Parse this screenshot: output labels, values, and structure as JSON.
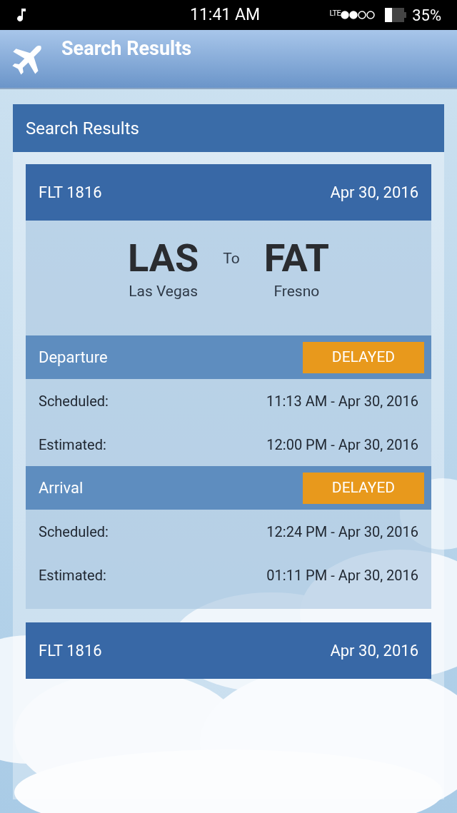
{
  "status_bar": {
    "time": "11:41 AM",
    "network": "LTE",
    "battery": "35%"
  },
  "app_bar": {
    "title": "Search Results"
  },
  "panel": {
    "title": "Search Results"
  },
  "flights": [
    {
      "flight": "FLT 1816",
      "date": "Apr 30, 2016",
      "origin": {
        "code": "LAS",
        "city": "Las Vegas"
      },
      "connector": "To",
      "destination": {
        "code": "FAT",
        "city": "Fresno"
      },
      "sections": [
        {
          "title": "Departure",
          "status": {
            "label": "DELAYED",
            "color": "#e8991c"
          },
          "rows": [
            {
              "label": "Scheduled:",
              "value": "11:13 AM - Apr 30, 2016"
            },
            {
              "label": "Estimated:",
              "value": "12:00 PM - Apr 30, 2016"
            }
          ]
        },
        {
          "title": "Arrival",
          "status": {
            "label": "DELAYED",
            "color": "#e8991c"
          },
          "rows": [
            {
              "label": "Scheduled:",
              "value": "12:24 PM - Apr 30, 2016"
            },
            {
              "label": "Estimated:",
              "value": "01:11 PM - Apr 30, 2016"
            }
          ]
        }
      ]
    },
    {
      "flight": "FLT 1816",
      "date": "Apr 30, 2016"
    }
  ]
}
